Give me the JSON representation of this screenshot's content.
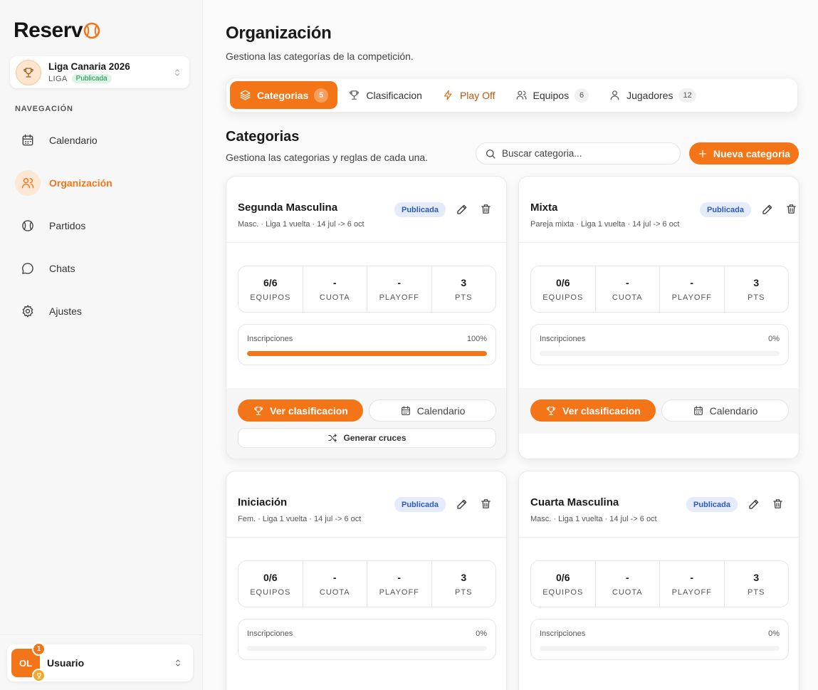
{
  "app": {
    "logo_text": "Reserv"
  },
  "league": {
    "name": "Liga Canaria 2026",
    "type": "LIGA",
    "status": "Publicada"
  },
  "nav": {
    "label": "NAVEGACIÓN",
    "items": [
      {
        "label": "Calendario",
        "icon": "calendar-icon",
        "active": false
      },
      {
        "label": "Organización",
        "icon": "users-icon",
        "active": true
      },
      {
        "label": "Partidos",
        "icon": "ball-icon",
        "active": false
      },
      {
        "label": "Chats",
        "icon": "chat-icon",
        "active": false
      },
      {
        "label": "Ajustes",
        "icon": "gear-icon",
        "active": false
      }
    ]
  },
  "user": {
    "initials": "OL",
    "name": "Usuario",
    "notifications": "1"
  },
  "page": {
    "title": "Organización",
    "subtitle": "Gestiona las categorías de la competición."
  },
  "tabs": [
    {
      "label": "Categorias",
      "count": "5",
      "active": true
    },
    {
      "label": "Clasificacion",
      "count": null
    },
    {
      "label": "Play Off",
      "count": null
    },
    {
      "label": "Equipos",
      "count": "6"
    },
    {
      "label": "Jugadores",
      "count": "12"
    }
  ],
  "section": {
    "title": "Categorias",
    "subtitle": "Gestiona las categorias y reglas de cada una.",
    "search_placeholder": "Buscar categoria...",
    "new_button": "Nueva categoria"
  },
  "labels": {
    "teams": "EQUIPOS",
    "fee": "CUOTA",
    "playoff": "PLAYOFF",
    "pts": "PTS",
    "registrations": "Inscripciones",
    "view_standings": "Ver clasificacion",
    "calendar": "Calendario",
    "generate": "Generar cruces"
  },
  "colors": {
    "accent": "#f47418",
    "badge_blue": "#2f5bbd",
    "badge_green": "#1f8a4e"
  },
  "categories": [
    {
      "name": "Segunda Masculina",
      "meta": "Masc. · Liga 1 vuelta · 14 jul -> 6 oct",
      "status": "Publicada",
      "teams": "6/6",
      "fee": "-",
      "playoff": "-",
      "pts": "3",
      "progress_pct": 100,
      "progress_label": "100%",
      "has_generate": true
    },
    {
      "name": "Mixta",
      "meta": "Pareja mixta · Liga 1 vuelta · 14 jul -> 6 oct",
      "status": "Publicada",
      "teams": "0/6",
      "fee": "-",
      "playoff": "-",
      "pts": "3",
      "progress_pct": 0,
      "progress_label": "0%",
      "has_generate": false
    },
    {
      "name": "Iniciación",
      "meta": "Fem. · Liga 1 vuelta · 14 jul -> 6 oct",
      "status": "Publicada",
      "teams": "0/6",
      "fee": "-",
      "playoff": "-",
      "pts": "3",
      "progress_pct": 0,
      "progress_label": "0%",
      "has_generate": false
    },
    {
      "name": "Cuarta Masculina",
      "meta": "Masc. · Liga 1 vuelta · 14 jul -> 6 oct",
      "status": "Publicada",
      "teams": "0/6",
      "fee": "-",
      "playoff": "-",
      "pts": "3",
      "progress_pct": 0,
      "progress_label": "0%",
      "has_generate": false
    }
  ]
}
